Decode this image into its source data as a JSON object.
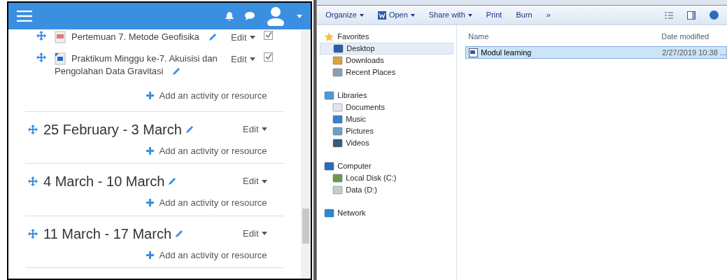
{
  "course": {
    "activities": [
      {
        "kind": "pdf",
        "lines": [
          "Pertemuan 7. Metode Geofisika"
        ],
        "edit": "Edit",
        "completed": true
      },
      {
        "kind": "word",
        "lines": [
          "Praktikum Minggu ke-7. Akuisisi dan",
          "Pengolahan Data Gravitasi"
        ],
        "edit": "Edit",
        "completed": true
      }
    ],
    "add_link": "Add an activity or resource",
    "sections": [
      {
        "title": "25 February - 3 March",
        "edit": "Edit",
        "add_link": "Add an activity or resource"
      },
      {
        "title": "4 March - 10 March",
        "edit": "Edit",
        "add_link": "Add an activity or resource"
      },
      {
        "title": "11 March - 17 March",
        "edit": "Edit",
        "add_link": "Add an activity or resource"
      }
    ]
  },
  "explorer": {
    "toolbar": [
      {
        "kind": "menu",
        "label": "Organize"
      },
      {
        "kind": "open",
        "label": "Open"
      },
      {
        "kind": "menu",
        "label": "Share with"
      },
      {
        "kind": "plain",
        "label": "Print"
      },
      {
        "kind": "plain",
        "label": "Burn"
      },
      {
        "kind": "plain",
        "label": "»"
      }
    ],
    "nav": [
      {
        "label": "Favorites",
        "children": [
          {
            "label": "Desktop",
            "selected": true
          },
          {
            "label": "Downloads",
            "selected": false
          },
          {
            "label": "Recent Places",
            "selected": false
          }
        ]
      },
      {
        "label": "Libraries",
        "children": [
          {
            "label": "Documents",
            "selected": false
          },
          {
            "label": "Music",
            "selected": false
          },
          {
            "label": "Pictures",
            "selected": false
          },
          {
            "label": "Videos",
            "selected": false
          }
        ]
      },
      {
        "label": "Computer",
        "children": [
          {
            "label": "Local Disk (C:)",
            "selected": false
          },
          {
            "label": "Data (D:)",
            "selected": false
          }
        ]
      },
      {
        "label": "Network"
      }
    ],
    "columns": [
      "Name",
      "Date modified"
    ],
    "files": [
      {
        "name": "Modul learning",
        "date": "2/27/2019 10:38 ...",
        "selected": true
      }
    ]
  }
}
